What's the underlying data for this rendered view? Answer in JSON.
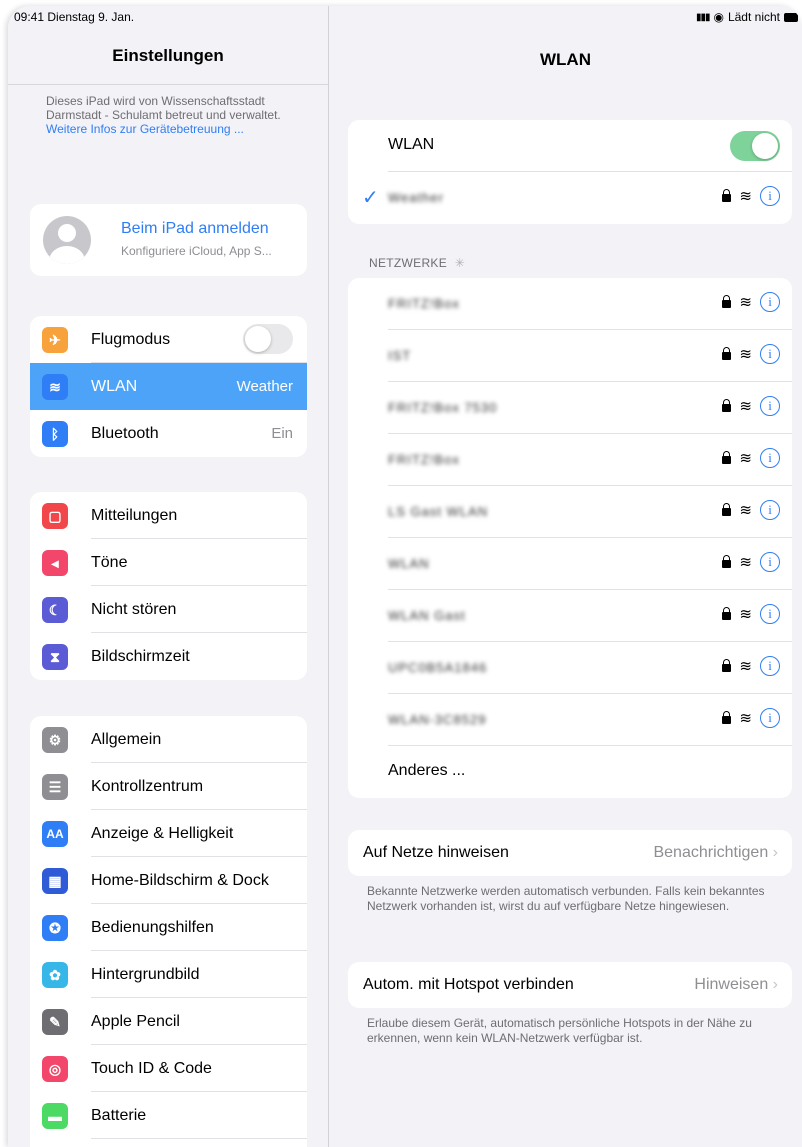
{
  "status_bar": {
    "time": "09:41",
    "date": "Dienstag 9. Jan.",
    "charging": "Lädt nicht"
  },
  "sidebar": {
    "title": "Einstellungen",
    "mgmt_note": "Dieses iPad wird von Wissenschaftsstadt Darmstadt - Schulamt betreut und verwaltet.",
    "mgmt_link": "Weitere Infos zur Gerätebetreuung ...",
    "profile": {
      "title": "Beim iPad anmelden",
      "subtitle": "Konfiguriere iCloud, App S..."
    },
    "group1": [
      {
        "label": "Flugmodus",
        "icon": "airplane-icon",
        "color": "#f7a23b"
      },
      {
        "label": "WLAN",
        "value": "Weather",
        "icon": "wifi-icon",
        "color": "#2f7ef5"
      },
      {
        "label": "Bluetooth",
        "value": "Ein",
        "icon": "bluetooth-icon",
        "color": "#2f7ef5"
      }
    ],
    "group2": [
      {
        "label": "Mitteilungen",
        "icon": "notifications-icon",
        "color": "#f2474a"
      },
      {
        "label": "Töne",
        "icon": "speaker-icon",
        "color": "#f2476a"
      },
      {
        "label": "Nicht stören",
        "icon": "moon-icon",
        "color": "#5b5bd6"
      },
      {
        "label": "Bildschirmzeit",
        "icon": "hourglass-icon",
        "color": "#5b5bd6"
      }
    ],
    "group3": [
      {
        "label": "Allgemein",
        "icon": "gear-icon",
        "color": "#8e8e93"
      },
      {
        "label": "Kontrollzentrum",
        "icon": "switches-icon",
        "color": "#8e8e93"
      },
      {
        "label": "Anzeige & Helligkeit",
        "icon": "text-size-icon",
        "color": "#2f7ef5"
      },
      {
        "label": "Home-Bildschirm & Dock",
        "icon": "grid-icon",
        "color": "#2f5cd6"
      },
      {
        "label": "Bedienungshilfen",
        "icon": "accessibility-icon",
        "color": "#2f7ef5"
      },
      {
        "label": "Hintergrundbild",
        "icon": "flower-icon",
        "color": "#36b7e8"
      },
      {
        "label": "Apple Pencil",
        "icon": "pencil-icon",
        "color": "#6d6d72"
      },
      {
        "label": "Touch ID & Code",
        "icon": "fingerprint-icon",
        "color": "#f2476a"
      },
      {
        "label": "Batterie",
        "icon": "battery-icon",
        "color": "#4cd964"
      }
    ]
  },
  "detail": {
    "title": "WLAN",
    "wlan_label": "WLAN",
    "connected_network": "Weather",
    "networks_header": "NETZWERKE",
    "networks": [
      "FRITZ!Box",
      "IST",
      "FRITZ!Box 7530",
      "FRITZ!Box",
      "LS Gast WLAN",
      "WLAN",
      "WLAN Gast",
      "UPC0B5A1846",
      "WLAN-3C8529"
    ],
    "other_label": "Anderes ...",
    "ask_join": {
      "label": "Auf Netze hinweisen",
      "value": "Benachrichtigen"
    },
    "ask_join_note": "Bekannte Netzwerke werden automatisch verbunden. Falls kein bekanntes Netzwerk vorhanden ist, wirst du auf verfügbare Netze hingewiesen.",
    "hotspot": {
      "label": "Autom. mit Hotspot verbinden",
      "value": "Hinweisen"
    },
    "hotspot_note": "Erlaube diesem Gerät, automatisch persönliche Hotspots in der Nähe zu erkennen, wenn kein WLAN-Netzwerk verfügbar ist."
  }
}
